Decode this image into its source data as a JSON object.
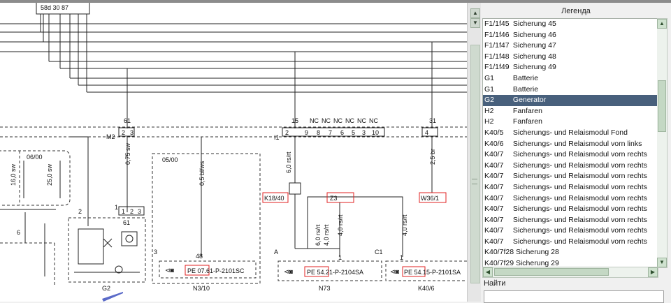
{
  "legend": {
    "title": "Легенда",
    "items": [
      {
        "code": "F1/1f45",
        "desc": "Sicherung 45",
        "selected": false
      },
      {
        "code": "F1/1f46",
        "desc": "Sicherung 46",
        "selected": false
      },
      {
        "code": "F1/1f47",
        "desc": "Sicherung 47",
        "selected": false
      },
      {
        "code": "F1/1f48",
        "desc": "Sicherung 48",
        "selected": false
      },
      {
        "code": "F1/1f49",
        "desc": "Sicherung 49",
        "selected": false
      },
      {
        "code": "G1",
        "desc": "Batterie",
        "selected": false
      },
      {
        "code": "G1",
        "desc": "Batterie",
        "selected": false
      },
      {
        "code": "G2",
        "desc": "Generator",
        "selected": true
      },
      {
        "code": "H2",
        "desc": "Fanfaren",
        "selected": false
      },
      {
        "code": "H2",
        "desc": "Fanfaren",
        "selected": false
      },
      {
        "code": "K40/5",
        "desc": "Sicherungs- und Relaismodul Fond",
        "selected": false
      },
      {
        "code": "K40/6",
        "desc": "Sicherungs- und Relaismodul vorn links",
        "selected": false
      },
      {
        "code": "K40/7",
        "desc": "Sicherungs- und Relaismodul vorn rechts",
        "selected": false
      },
      {
        "code": "K40/7",
        "desc": "Sicherungs- und Relaismodul vorn rechts",
        "selected": false
      },
      {
        "code": "K40/7",
        "desc": "Sicherungs- und Relaismodul vorn rechts",
        "selected": false
      },
      {
        "code": "K40/7",
        "desc": "Sicherungs- und Relaismodul vorn rechts",
        "selected": false
      },
      {
        "code": "K40/7",
        "desc": "Sicherungs- und Relaismodul vorn rechts",
        "selected": false
      },
      {
        "code": "K40/7",
        "desc": "Sicherungs- und Relaismodul vorn rechts",
        "selected": false
      },
      {
        "code": "K40/7",
        "desc": "Sicherungs- und Relaismodul vorn rechts",
        "selected": false
      },
      {
        "code": "K40/7",
        "desc": "Sicherungs- und Relaismodul vorn rechts",
        "selected": false
      },
      {
        "code": "K40/7",
        "desc": "Sicherungs- und Relaismodul vorn rechts",
        "selected": false
      },
      {
        "code": "K40/7f28",
        "desc": "Sicherung 28",
        "selected": false
      },
      {
        "code": "K40/7f29",
        "desc": "Sicherung 29",
        "selected": false
      }
    ]
  },
  "find": {
    "label": "Найти",
    "value": ""
  },
  "scroll_glyphs": {
    "up": "▲",
    "down": "▼",
    "left": "◀",
    "right": "▶"
  },
  "diagram": {
    "top_labels": "58d  30  87",
    "connector_labels": {
      "m2": "M2",
      "i1": "I1",
      "p61": "61",
      "p15": "15",
      "p31": "31",
      "nc": [
        "NC",
        "NC",
        "NC",
        "NC",
        "NC",
        "NC"
      ],
      "pins_m2": [
        "2",
        "3"
      ],
      "pins_i1": [
        "2",
        "9",
        "8",
        "7",
        "6",
        "5",
        "3",
        "10"
      ],
      "pin_31": "4"
    },
    "wire_labels": {
      "w1": "0,75 sw",
      "w2": "0,5 bl/ws",
      "w3": "6,0 rs/rt",
      "w4": "2,5 br",
      "w5": "6,0 rs/rt",
      "w6": "4,0 rs/rt",
      "w7": "4,0 rs/rt",
      "w8": "4,0 rs/rt",
      "w9": "16,0 sw",
      "w10": "25,0 sw"
    },
    "block_labels": {
      "b0600": "06/00",
      "b0500": "05/00",
      "g2": "G2",
      "n310": "N3/10",
      "n73": "N73",
      "k406": "K40/6",
      "n_2": "2",
      "n_1": "1",
      "n_6": "6",
      "n_3": "3",
      "n_48": "48",
      "n_A": "A",
      "n_1b": "1",
      "n_C1": "C1",
      "n_61": "61",
      "n_1c": "1",
      "n_2b": "2",
      "n_3b": "3",
      "n_1d": "1",
      "n_2c": "2",
      "n_1e": "1",
      "pe1": "PE 07.61-P-2101SC",
      "pe2": "PE 54.21-P-2104SA",
      "pe3": "PE 54.15-P-2101SA"
    },
    "ref_boxes": {
      "k1840": "K18/40",
      "z3": "Z3",
      "w361": "W36/1"
    }
  }
}
